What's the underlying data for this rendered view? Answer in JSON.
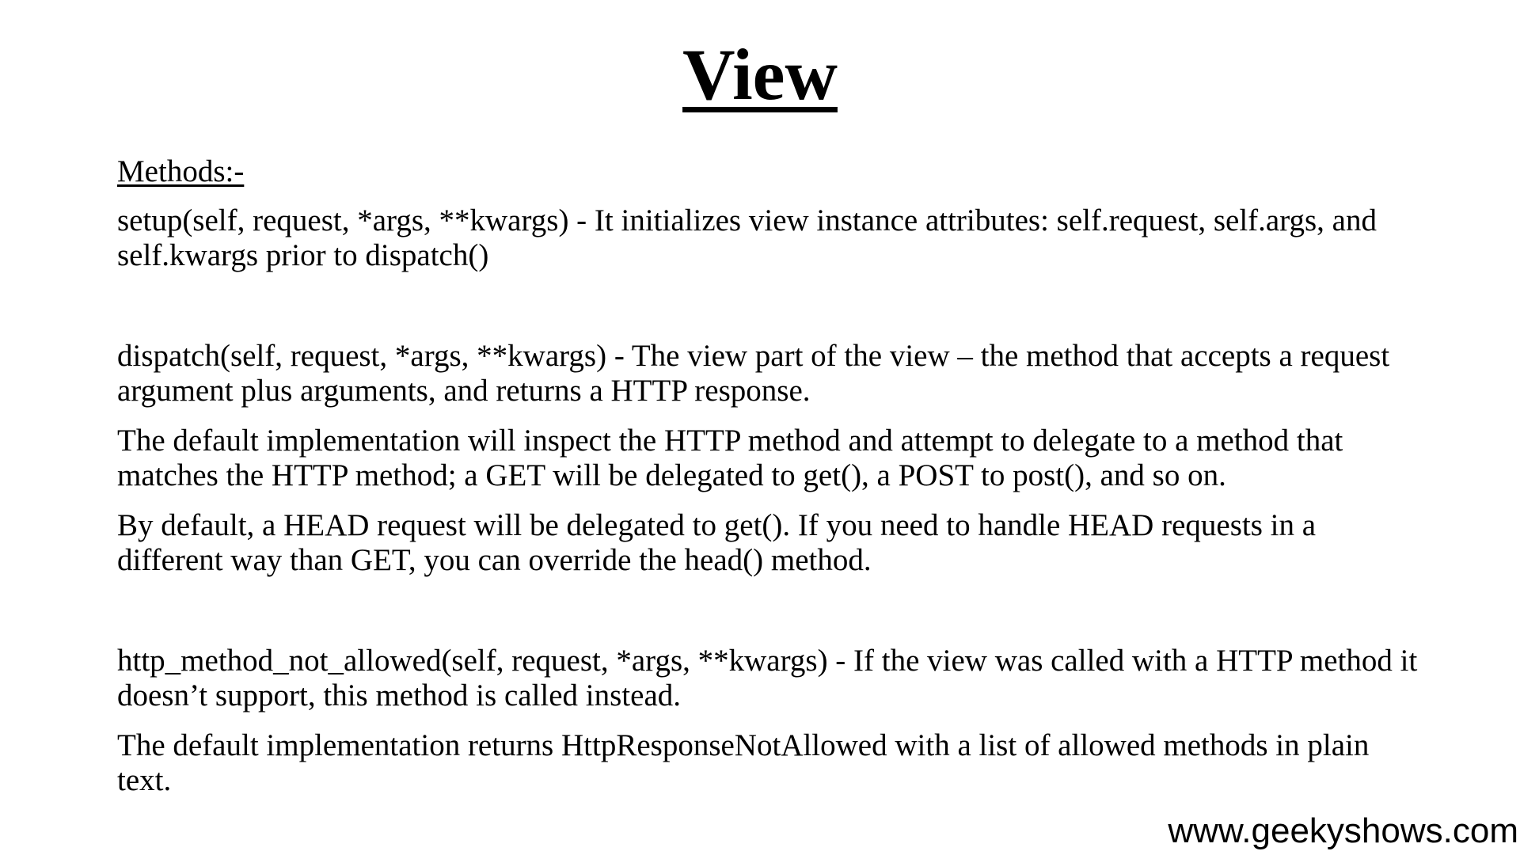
{
  "slide": {
    "title": "View",
    "section_heading": "Methods:-",
    "paragraphs": [
      "setup(self, request, *args, **kwargs) -  It initializes view instance attributes: self.request, self.args, and self.kwargs prior to dispatch()",
      "dispatch(self, request, *args, **kwargs) -  The view part of the view – the method that accepts a request argument plus arguments, and returns a HTTP response.",
      "The default implementation will inspect the HTTP method and attempt to delegate to a method that matches the HTTP method; a GET will be delegated to get(), a POST to post(), and so on.",
      "By default, a HEAD request will be delegated to get(). If you need to handle HEAD requests in a different way than GET, you can override the head() method.",
      "http_method_not_allowed(self, request, *args, **kwargs) - If the view was called with a HTTP method it doesn’t support, this method is called instead.",
      "The default implementation returns HttpResponseNotAllowed with a list of allowed methods in plain text."
    ],
    "footer": "www.geekyshows.com"
  }
}
